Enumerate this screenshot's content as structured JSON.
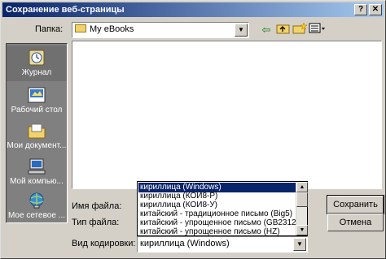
{
  "window": {
    "title": "Сохранение веб-страницы"
  },
  "titlebar": {
    "help_glyph": "?",
    "close_glyph": "✕"
  },
  "folder": {
    "label": "Папка:",
    "value": "My eBooks"
  },
  "places": [
    {
      "label": "Журнал",
      "icon": "history-icon"
    },
    {
      "label": "Рабочий стол",
      "icon": "desktop-icon"
    },
    {
      "label": "Мои документ...",
      "icon": "my-documents-icon"
    },
    {
      "label": "Мой компью...",
      "icon": "my-computer-icon"
    },
    {
      "label": "Мое сетевое ...",
      "icon": "network-places-icon"
    }
  ],
  "fields": {
    "filename_label": "Имя файла:",
    "filetype_label": "Тип файла:",
    "encoding_label": "Вид кодировки:",
    "encoding_value": "кириллица (Windows)"
  },
  "buttons": {
    "save": "Сохранить",
    "cancel": "Отмена"
  },
  "encoding_options": [
    "кириллица (Windows)",
    "кириллица (КОИ8-Р)",
    "кириллица (КОИ8-У)",
    "китайский - традиционное письмо (Big5)",
    "китайский - упрощенное письмо  (GB2312)",
    "китайский - упрощенное письмо (HZ)"
  ]
}
